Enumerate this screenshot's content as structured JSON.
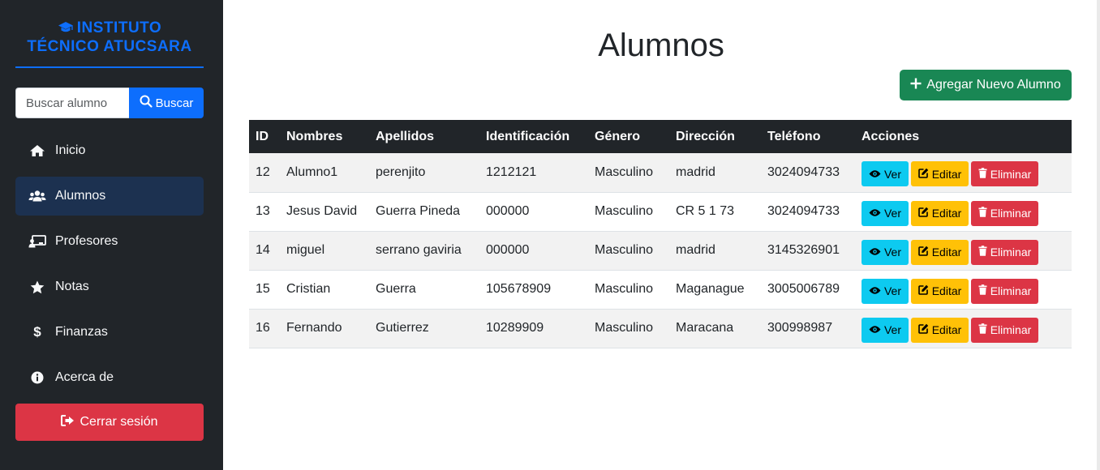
{
  "brand": {
    "line1": "INSTITUTO",
    "line2": "TÉCNICO ATUCSARA",
    "icon": "graduation-cap-icon"
  },
  "search": {
    "placeholder": "Buscar alumno",
    "value": "",
    "button_label": "Buscar"
  },
  "sidebar": {
    "items": [
      {
        "label": "Inicio",
        "icon": "home-icon",
        "active": false
      },
      {
        "label": "Alumnos",
        "icon": "users-icon",
        "active": true
      },
      {
        "label": "Profesores",
        "icon": "chalkboard-teacher-icon",
        "active": false
      },
      {
        "label": "Notas",
        "icon": "star-icon",
        "active": false
      },
      {
        "label": "Finanzas",
        "icon": "dollar-icon",
        "active": false
      },
      {
        "label": "Acerca de",
        "icon": "info-icon",
        "active": false
      }
    ],
    "logout_label": "Cerrar sesión"
  },
  "main": {
    "title": "Alumnos",
    "add_button_label": "Agregar Nuevo Alumno",
    "table": {
      "columns": [
        "ID",
        "Nombres",
        "Apellidos",
        "Identificación",
        "Género",
        "Dirección",
        "Teléfono",
        "Acciones"
      ],
      "rows": [
        {
          "id": "12",
          "nombres": "Alumno1",
          "apellidos": "perenjito",
          "identificacion": "1212121",
          "genero": "Masculino",
          "direccion": "madrid",
          "telefono": "3024094733"
        },
        {
          "id": "13",
          "nombres": "Jesus David",
          "apellidos": "Guerra Pineda",
          "identificacion": "000000",
          "genero": "Masculino",
          "direccion": "CR 5 1 73",
          "telefono": "3024094733"
        },
        {
          "id": "14",
          "nombres": "miguel",
          "apellidos": "serrano gaviria",
          "identificacion": "000000",
          "genero": "Masculino",
          "direccion": "madrid",
          "telefono": "3145326901"
        },
        {
          "id": "15",
          "nombres": "Cristian",
          "apellidos": "Guerra",
          "identificacion": "105678909",
          "genero": "Masculino",
          "direccion": "Maganague",
          "telefono": "3005006789"
        },
        {
          "id": "16",
          "nombres": "Fernando",
          "apellidos": "Gutierrez",
          "identificacion": "10289909",
          "genero": "Masculino",
          "direccion": "Maracana",
          "telefono": "300998987"
        }
      ],
      "actions": {
        "view_label": "Ver",
        "edit_label": "Editar",
        "delete_label": "Eliminar"
      }
    }
  },
  "colors": {
    "sidebar_bg": "#212529",
    "primary": "#0d6efd",
    "success": "#198754",
    "danger": "#dc3545",
    "info": "#0dcaf0",
    "warning": "#ffc107",
    "active_nav": "#1c3150"
  }
}
